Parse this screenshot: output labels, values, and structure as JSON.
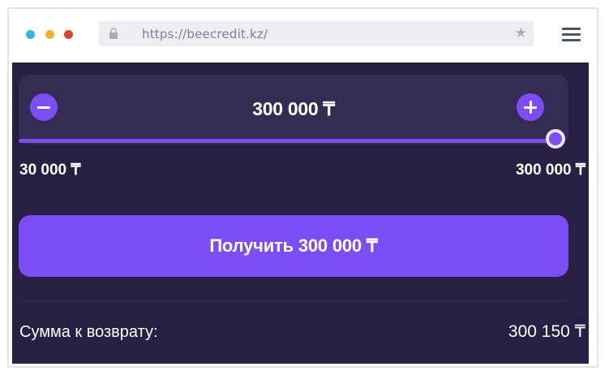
{
  "browser": {
    "url": "https://beecredit.kz/",
    "window_dots": [
      "#32b6e8",
      "#f5b324",
      "#e0442c"
    ]
  },
  "loan": {
    "amount_display": "300 000 ₸",
    "min_label": "30 000 ₸",
    "max_label": "300 000 ₸",
    "slider_value": 1.0,
    "cta_label": "Получить 300 000  ₸",
    "repay_label": "Сумма к возврату:",
    "repay_value": "300 150  ₸"
  },
  "colors": {
    "accent": "#7c4cf4",
    "background": "#272042",
    "card": "#342c52"
  }
}
